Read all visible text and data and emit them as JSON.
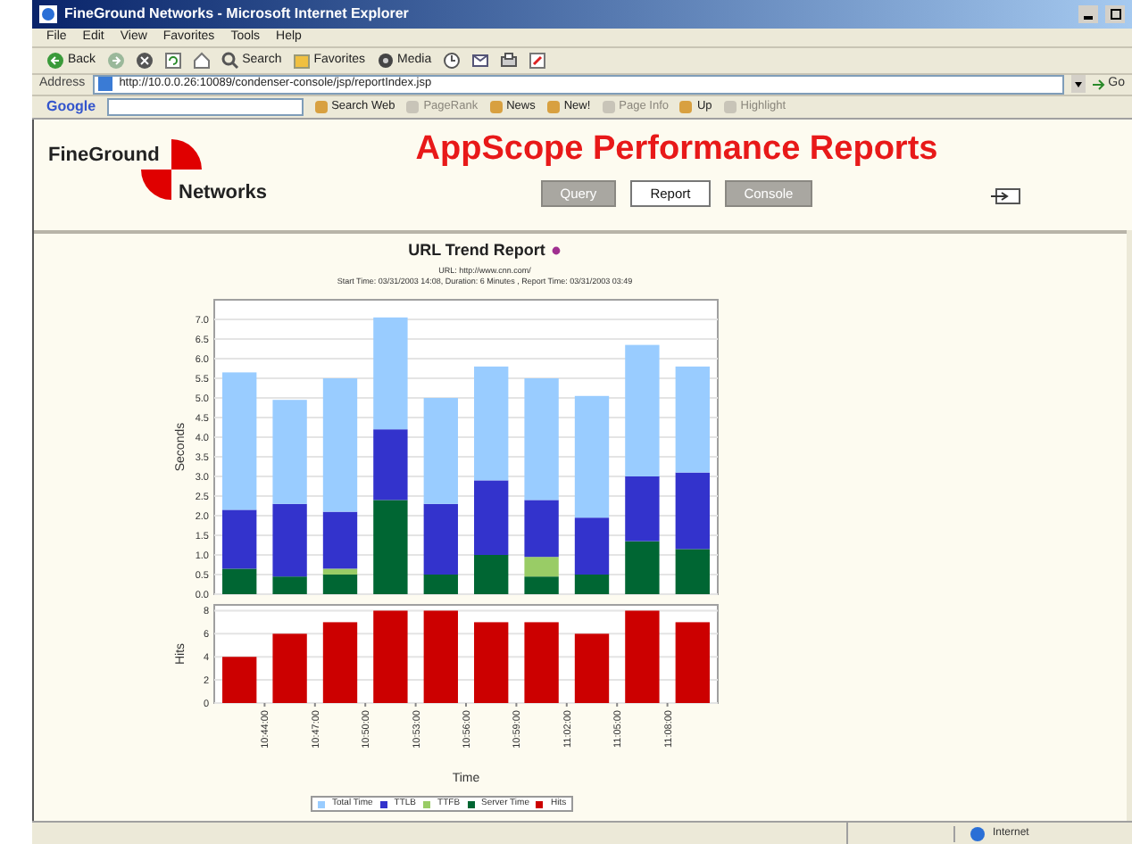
{
  "window": {
    "title": "FineGround Networks - Microsoft Internet Explorer"
  },
  "menu": [
    "File",
    "Edit",
    "View",
    "Favorites",
    "Tools",
    "Help"
  ],
  "toolbar": [
    {
      "kind": "back",
      "label": "Back"
    },
    {
      "kind": "forward"
    },
    {
      "kind": "stop"
    },
    {
      "kind": "refresh"
    },
    {
      "kind": "home"
    },
    {
      "kind": "search",
      "label": "Search"
    },
    {
      "kind": "favorites",
      "label": "Favorites"
    },
    {
      "kind": "media",
      "label": "Media"
    },
    {
      "kind": "history"
    },
    {
      "kind": "mail"
    },
    {
      "kind": "print"
    },
    {
      "kind": "edit"
    }
  ],
  "address": {
    "label": "Address",
    "value": "http://10.0.0.26:10089/condenser-console/jsp/reportIndex.jsp",
    "go": "Go"
  },
  "google_bar": {
    "logo": "Google",
    "items": [
      {
        "label": "Search Web",
        "disabled": false
      },
      {
        "label": "PageRank",
        "disabled": true
      },
      {
        "label": "News",
        "disabled": false
      },
      {
        "label": "New!",
        "disabled": false
      },
      {
        "label": "Page Info",
        "disabled": true
      },
      {
        "label": "Up",
        "disabled": false
      },
      {
        "label": "Highlight",
        "disabled": true
      }
    ]
  },
  "page": {
    "logo": [
      "FineGround",
      "Networks"
    ],
    "title": "AppScope Performance Reports",
    "nav": [
      {
        "label": "Query",
        "selected": false
      },
      {
        "label": "Report",
        "selected": true
      },
      {
        "label": "Console",
        "selected": false
      }
    ],
    "report": {
      "title": "URL Trend Report",
      "url_line": "URL: http://www.cnn.com/",
      "time_line": "Start Time: 03/31/2003 14:08, Duration: 6 Minutes , Report Time: 03/31/2003 03:49",
      "seconds_chart": {
        "chart_data": {
          "type": "bar",
          "ylabel": "Seconds",
          "ylim": [
            0,
            7.5
          ],
          "yticks": [
            {
              "value": 0,
              "label": "0.0"
            },
            {
              "value": 0.5,
              "label": "0.5"
            },
            {
              "value": 1,
              "label": "1.0"
            },
            {
              "value": 1.5,
              "label": "1.5"
            },
            {
              "value": 2,
              "label": "2.0"
            },
            {
              "value": 2.5,
              "label": "2.5"
            },
            {
              "value": 3,
              "label": "3.0"
            },
            {
              "value": 3.5,
              "label": "3.5"
            },
            {
              "value": 4,
              "label": "4.0"
            },
            {
              "value": 4.5,
              "label": "4.5"
            },
            {
              "value": 5,
              "label": "5.0"
            },
            {
              "value": 5.5,
              "label": "5.5"
            },
            {
              "value": 6,
              "label": "6.0"
            },
            {
              "value": 6.5,
              "label": "6.5"
            },
            {
              "value": 7,
              "label": "7.0"
            }
          ],
          "stacked": true,
          "grid": true,
          "legend": true,
          "series": [
            {
              "name": "Total Time",
              "color": "#99ccff",
              "values": [
                3.5,
                2.65,
                3.4,
                2.85,
                2.7,
                2.9,
                3.1,
                3.1,
                3.35,
                2.7
              ]
            },
            {
              "name": "TTLB",
              "color": "#3333cc",
              "values": [
                1.5,
                1.85,
                1.45,
                1.8,
                1.8,
                1.9,
                1.45,
                1.45,
                1.65,
                1.95
              ]
            },
            {
              "name": "TTFB",
              "color": "#99cc66",
              "values": [
                0,
                0,
                0.15,
                0,
                0,
                0,
                0.5,
                0,
                0,
                0
              ]
            },
            {
              "name": "Server Time",
              "color": "#006633",
              "values": [
                0.65,
                0.45,
                0.5,
                2.4,
                0.5,
                1.0,
                0.45,
                0.5,
                1.35,
                1.15
              ]
            }
          ]
        }
      },
      "hits_chart": {
        "chart_data": {
          "type": "bar",
          "ylabel": "Hits",
          "xlabel": "Time",
          "categories": [
            "10:44:00",
            "10:47:00",
            "10:50:00",
            "10:53:00",
            "10:56:00",
            "10:59:00",
            "11:02:00",
            "11:05:00",
            "11:08:00",
            null
          ],
          "ylim": [
            0,
            8.5
          ],
          "yticks": [
            0,
            2,
            4,
            6,
            8
          ],
          "grid": true,
          "series": [
            {
              "name": "Hits",
              "color": "#cc0000",
              "values": [
                4,
                6,
                7,
                8,
                8,
                7,
                7,
                6,
                8,
                7
              ]
            }
          ]
        }
      }
    }
  },
  "status_bar": {
    "zone": "Internet"
  }
}
